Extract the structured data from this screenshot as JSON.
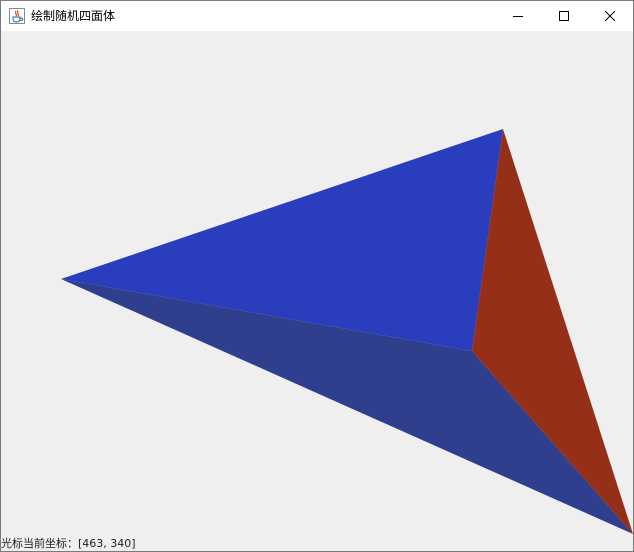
{
  "window": {
    "title": "绘制随机四面体",
    "icon": "java-cup-icon",
    "controls": {
      "minimize": "minimize-icon",
      "maximize": "maximize-icon",
      "close": "close-icon"
    }
  },
  "tetrahedron": {
    "colors": {
      "top_face": "#2a3dbd",
      "bottom_face": "#2f3f8e",
      "right_face": "#952f17",
      "background": "#efefef"
    }
  },
  "status": {
    "label": "光标当前坐标：[463, 340]"
  }
}
